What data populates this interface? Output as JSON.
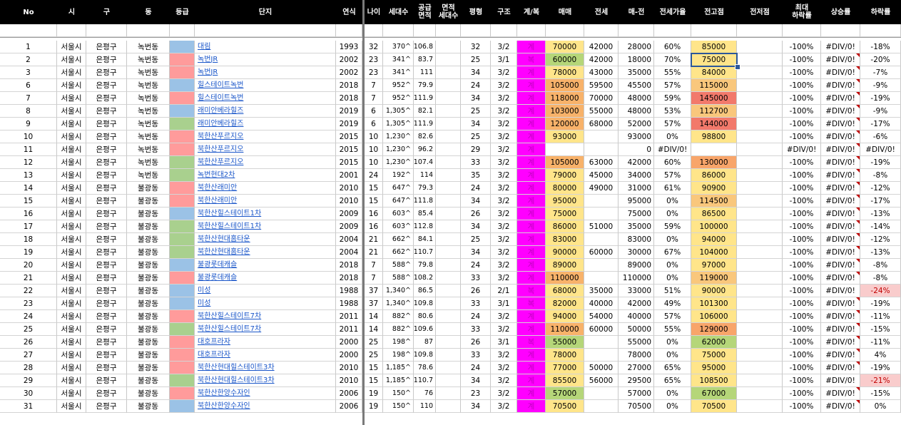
{
  "colors": {
    "header_bg": "#000000",
    "header_text": "#ffffff",
    "grade_blue": "#9bc2e6",
    "grade_red": "#ff9b9b",
    "grade_green": "#a9d08e",
    "jeon_magenta": "#ff00ff",
    "link": "#1a56c9",
    "sale_yellow": "#ffe58a",
    "sale_green": "#b5d679",
    "sale_orange": "#f8b26a",
    "peak_yellow": "#ffe58a",
    "peak_lightorange": "#f9c77c",
    "peak_orange": "#f8a56a",
    "peak_red": "#f2796b",
    "peak_green": "#b5d679",
    "drop_pink": "#f9cccc",
    "selection": "#2b579a"
  },
  "headers": [
    "No",
    "시",
    "구",
    "동",
    "등급",
    "단지",
    "연식",
    "나이",
    "세대수",
    "공급\n면적",
    "면적\n세대수",
    "평형",
    "구조",
    "계/복",
    "매매",
    "전세",
    "매-전",
    "전세가율",
    "전고점",
    "전저점",
    "최대\n하락률",
    "상승률",
    "하락률"
  ],
  "rows": [
    {
      "no": "1",
      "si": "서울시",
      "gu": "은평구",
      "dong": "녹번동",
      "grade": "blue",
      "danji": "대림",
      "year": "1993",
      "age": "32",
      "units": "370^",
      "area": "106.8",
      "area_units": "",
      "pyeong": "32",
      "struct": "3/2",
      "gb": "계",
      "sale": "70000",
      "sale_c": "yellow",
      "jeon": "42000",
      "mj": "28000",
      "rate": "60%",
      "peak": "85000",
      "peak_c": "yellow",
      "low": "",
      "maxdrop": "-100%",
      "rise": "#DIV/0!",
      "rise_mark": false,
      "drop": "-18%",
      "drop_c": ""
    },
    {
      "no": "2",
      "si": "서울시",
      "gu": "은평구",
      "dong": "녹번동",
      "grade": "red",
      "danji": "녹번JR",
      "year": "2002",
      "age": "23",
      "units": "341^",
      "area": "83.7",
      "area_units": "",
      "pyeong": "25",
      "struct": "3/1",
      "gb": "복",
      "sale": "60000",
      "sale_c": "green",
      "jeon": "42000",
      "mj": "18000",
      "rate": "70%",
      "peak": "75000",
      "peak_c": "yellow",
      "low": "",
      "maxdrop": "-100%",
      "rise": "#DIV/0!",
      "rise_mark": true,
      "drop": "-20%",
      "drop_c": ""
    },
    {
      "no": "3",
      "si": "서울시",
      "gu": "은평구",
      "dong": "녹번동",
      "grade": "red",
      "danji": "녹번JR",
      "year": "2002",
      "age": "23",
      "units": "341^",
      "area": "111",
      "area_units": "",
      "pyeong": "34",
      "struct": "3/2",
      "gb": "계",
      "sale": "78000",
      "sale_c": "yellow",
      "jeon": "43000",
      "mj": "35000",
      "rate": "55%",
      "peak": "84000",
      "peak_c": "yellow",
      "low": "",
      "maxdrop": "-100%",
      "rise": "#DIV/0!",
      "rise_mark": true,
      "drop": "-7%",
      "drop_c": ""
    },
    {
      "no": "6",
      "si": "서울시",
      "gu": "은평구",
      "dong": "녹번동",
      "grade": "blue",
      "danji": "힐스테이트녹번",
      "year": "2018",
      "age": "7",
      "units": "952^",
      "area": "79.9",
      "area_units": "",
      "pyeong": "24",
      "struct": "3/2",
      "gb": "계",
      "sale": "105000",
      "sale_c": "orange",
      "jeon": "59500",
      "mj": "45500",
      "rate": "57%",
      "peak": "115000",
      "peak_c": "lightorange",
      "low": "",
      "maxdrop": "-100%",
      "rise": "#DIV/0!",
      "rise_mark": true,
      "drop": "-9%",
      "drop_c": ""
    },
    {
      "no": "7",
      "si": "서울시",
      "gu": "은평구",
      "dong": "녹번동",
      "grade": "red",
      "danji": "힐스테이트녹번",
      "year": "2018",
      "age": "7",
      "units": "952^",
      "area": "111.9",
      "area_units": "",
      "pyeong": "34",
      "struct": "3/2",
      "gb": "계",
      "sale": "118000",
      "sale_c": "orange",
      "jeon": "70000",
      "mj": "48000",
      "rate": "59%",
      "peak": "145000",
      "peak_c": "red",
      "low": "",
      "maxdrop": "-100%",
      "rise": "#DIV/0!",
      "rise_mark": true,
      "drop": "-19%",
      "drop_c": ""
    },
    {
      "no": "8",
      "si": "서울시",
      "gu": "은평구",
      "dong": "녹번동",
      "grade": "blue",
      "danji": "래미안베라힐즈",
      "year": "2019",
      "age": "6",
      "units": "1,305^",
      "area": "82.1",
      "area_units": "",
      "pyeong": "25",
      "struct": "3/2",
      "gb": "계",
      "sale": "103000",
      "sale_c": "orange",
      "jeon": "55000",
      "mj": "48000",
      "rate": "53%",
      "peak": "112700",
      "peak_c": "lightorange",
      "low": "",
      "maxdrop": "-100%",
      "rise": "#DIV/0!",
      "rise_mark": true,
      "drop": "-9%",
      "drop_c": ""
    },
    {
      "no": "9",
      "si": "서울시",
      "gu": "은평구",
      "dong": "녹번동",
      "grade": "green",
      "danji": "래미안베라힐즈",
      "year": "2019",
      "age": "6",
      "units": "1,305^",
      "area": "111.9",
      "area_units": "",
      "pyeong": "34",
      "struct": "3/2",
      "gb": "계",
      "sale": "120000",
      "sale_c": "orange",
      "jeon": "68000",
      "mj": "52000",
      "rate": "57%",
      "peak": "144000",
      "peak_c": "red",
      "low": "",
      "maxdrop": "-100%",
      "rise": "#DIV/0!",
      "rise_mark": true,
      "drop": "-17%",
      "drop_c": ""
    },
    {
      "no": "10",
      "si": "서울시",
      "gu": "은평구",
      "dong": "녹번동",
      "grade": "red",
      "danji": "북한산푸르지오",
      "year": "2015",
      "age": "10",
      "units": "1,230^",
      "area": "82.6",
      "area_units": "",
      "pyeong": "25",
      "struct": "3/2",
      "gb": "계",
      "sale": "93000",
      "sale_c": "yellow",
      "jeon": "",
      "mj": "93000",
      "rate": "0%",
      "peak": "98800",
      "peak_c": "yellow",
      "low": "",
      "maxdrop": "-100%",
      "rise": "#DIV/0!",
      "rise_mark": true,
      "drop": "-6%",
      "drop_c": ""
    },
    {
      "no": "11",
      "si": "서울시",
      "gu": "은평구",
      "dong": "녹번동",
      "grade": "red",
      "danji": "북한산푸르지오",
      "year": "2015",
      "age": "10",
      "units": "1,230^",
      "area": "96.2",
      "area_units": "",
      "pyeong": "29",
      "struct": "3/2",
      "gb": "계",
      "sale": "",
      "sale_c": "",
      "jeon": "",
      "mj": "0",
      "rate": "#DIV/0!",
      "peak": "",
      "peak_c": "",
      "low": "",
      "maxdrop": "#DIV/0!",
      "rise": "#DIV/0!",
      "rise_mark": true,
      "drop": "#DIV/0!",
      "drop_c": ""
    },
    {
      "no": "12",
      "si": "서울시",
      "gu": "은평구",
      "dong": "녹번동",
      "grade": "green",
      "danji": "북한산푸르지오",
      "year": "2015",
      "age": "10",
      "units": "1,230^",
      "area": "107.4",
      "area_units": "",
      "pyeong": "33",
      "struct": "3/2",
      "gb": "계",
      "sale": "105000",
      "sale_c": "orange",
      "jeon": "63000",
      "mj": "42000",
      "rate": "60%",
      "peak": "130000",
      "peak_c": "orange",
      "low": "",
      "maxdrop": "-100%",
      "rise": "#DIV/0!",
      "rise_mark": true,
      "drop": "-19%",
      "drop_c": ""
    },
    {
      "no": "13",
      "si": "서울시",
      "gu": "은평구",
      "dong": "녹번동",
      "grade": "green",
      "danji": "녹번현대2차",
      "year": "2001",
      "age": "24",
      "units": "192^",
      "area": "114",
      "area_units": "",
      "pyeong": "35",
      "struct": "3/2",
      "gb": "계",
      "sale": "79000",
      "sale_c": "yellow",
      "jeon": "45000",
      "mj": "34000",
      "rate": "57%",
      "peak": "86000",
      "peak_c": "yellow",
      "low": "",
      "maxdrop": "-100%",
      "rise": "#DIV/0!",
      "rise_mark": true,
      "drop": "-8%",
      "drop_c": ""
    },
    {
      "no": "14",
      "si": "서울시",
      "gu": "은평구",
      "dong": "불광동",
      "grade": "red",
      "danji": "북한산래미안",
      "year": "2010",
      "age": "15",
      "units": "647^",
      "area": "79.3",
      "area_units": "",
      "pyeong": "24",
      "struct": "3/2",
      "gb": "계",
      "sale": "80000",
      "sale_c": "yellow",
      "jeon": "49000",
      "mj": "31000",
      "rate": "61%",
      "peak": "90900",
      "peak_c": "yellow",
      "low": "",
      "maxdrop": "-100%",
      "rise": "#DIV/0!",
      "rise_mark": true,
      "drop": "-12%",
      "drop_c": ""
    },
    {
      "no": "15",
      "si": "서울시",
      "gu": "은평구",
      "dong": "불광동",
      "grade": "red",
      "danji": "북한산래미안",
      "year": "2010",
      "age": "15",
      "units": "647^",
      "area": "111.8",
      "area_units": "",
      "pyeong": "34",
      "struct": "3/2",
      "gb": "계",
      "sale": "95000",
      "sale_c": "yellow",
      "jeon": "",
      "mj": "95000",
      "rate": "0%",
      "peak": "114500",
      "peak_c": "lightorange",
      "low": "",
      "maxdrop": "-100%",
      "rise": "#DIV/0!",
      "rise_mark": true,
      "drop": "-17%",
      "drop_c": ""
    },
    {
      "no": "16",
      "si": "서울시",
      "gu": "은평구",
      "dong": "불광동",
      "grade": "blue",
      "danji": "북한산힐스테이트1차",
      "year": "2009",
      "age": "16",
      "units": "603^",
      "area": "85.4",
      "area_units": "",
      "pyeong": "26",
      "struct": "3/2",
      "gb": "계",
      "sale": "75000",
      "sale_c": "yellow",
      "jeon": "",
      "mj": "75000",
      "rate": "0%",
      "peak": "86500",
      "peak_c": "yellow",
      "low": "",
      "maxdrop": "-100%",
      "rise": "#DIV/0!",
      "rise_mark": true,
      "drop": "-13%",
      "drop_c": ""
    },
    {
      "no": "17",
      "si": "서울시",
      "gu": "은평구",
      "dong": "불광동",
      "grade": "green",
      "danji": "북한산힐스테이트1차",
      "year": "2009",
      "age": "16",
      "units": "603^",
      "area": "112.8",
      "area_units": "",
      "pyeong": "34",
      "struct": "3/2",
      "gb": "계",
      "sale": "86000",
      "sale_c": "yellow",
      "jeon": "51000",
      "mj": "35000",
      "rate": "59%",
      "peak": "100000",
      "peak_c": "yellow",
      "low": "",
      "maxdrop": "-100%",
      "rise": "#DIV/0!",
      "rise_mark": true,
      "drop": "-14%",
      "drop_c": ""
    },
    {
      "no": "18",
      "si": "서울시",
      "gu": "은평구",
      "dong": "불광동",
      "grade": "green",
      "danji": "북한산현대홈타운",
      "year": "2004",
      "age": "21",
      "units": "662^",
      "area": "84.1",
      "area_units": "",
      "pyeong": "25",
      "struct": "3/2",
      "gb": "계",
      "sale": "83000",
      "sale_c": "yellow",
      "jeon": "",
      "mj": "83000",
      "rate": "0%",
      "peak": "94000",
      "peak_c": "yellow",
      "low": "",
      "maxdrop": "-100%",
      "rise": "#DIV/0!",
      "rise_mark": true,
      "drop": "-12%",
      "drop_c": ""
    },
    {
      "no": "19",
      "si": "서울시",
      "gu": "은평구",
      "dong": "불광동",
      "grade": "green",
      "danji": "북한산현대홈타운",
      "year": "2004",
      "age": "21",
      "units": "662^",
      "area": "110.7",
      "area_units": "",
      "pyeong": "34",
      "struct": "3/2",
      "gb": "계",
      "sale": "90000",
      "sale_c": "yellow",
      "jeon": "60000",
      "mj": "30000",
      "rate": "67%",
      "peak": "104000",
      "peak_c": "yellow",
      "low": "",
      "maxdrop": "-100%",
      "rise": "#DIV/0!",
      "rise_mark": true,
      "drop": "-13%",
      "drop_c": ""
    },
    {
      "no": "20",
      "si": "서울시",
      "gu": "은평구",
      "dong": "불광동",
      "grade": "blue",
      "danji": "불광롯데캐슬",
      "year": "2018",
      "age": "7",
      "units": "588^",
      "area": "79.8",
      "area_units": "",
      "pyeong": "24",
      "struct": "3/2",
      "gb": "계",
      "sale": "89000",
      "sale_c": "yellow",
      "jeon": "",
      "mj": "89000",
      "rate": "0%",
      "peak": "97000",
      "peak_c": "yellow",
      "low": "",
      "maxdrop": "-100%",
      "rise": "#DIV/0!",
      "rise_mark": true,
      "drop": "-8%",
      "drop_c": ""
    },
    {
      "no": "21",
      "si": "서울시",
      "gu": "은평구",
      "dong": "불광동",
      "grade": "red",
      "danji": "불광롯데캐슬",
      "year": "2018",
      "age": "7",
      "units": "588^",
      "area": "108.2",
      "area_units": "",
      "pyeong": "33",
      "struct": "3/2",
      "gb": "계",
      "sale": "110000",
      "sale_c": "orange",
      "jeon": "",
      "mj": "110000",
      "rate": "0%",
      "peak": "119000",
      "peak_c": "lightorange",
      "low": "",
      "maxdrop": "-100%",
      "rise": "#DIV/0!",
      "rise_mark": true,
      "drop": "-8%",
      "drop_c": ""
    },
    {
      "no": "22",
      "si": "서울시",
      "gu": "은평구",
      "dong": "불광동",
      "grade": "blue",
      "danji": "미성",
      "year": "1988",
      "age": "37",
      "units": "1,340^",
      "area": "86.5",
      "area_units": "",
      "pyeong": "26",
      "struct": "2/1",
      "gb": "복",
      "sale": "68000",
      "sale_c": "yellow",
      "jeon": "35000",
      "mj": "33000",
      "rate": "51%",
      "peak": "90000",
      "peak_c": "yellow",
      "low": "",
      "maxdrop": "-100%",
      "rise": "#DIV/0!",
      "rise_mark": false,
      "drop": "-24%",
      "drop_c": "pink"
    },
    {
      "no": "23",
      "si": "서울시",
      "gu": "은평구",
      "dong": "불광동",
      "grade": "blue",
      "danji": "미성",
      "year": "1988",
      "age": "37",
      "units": "1,340^",
      "area": "109.8",
      "area_units": "",
      "pyeong": "33",
      "struct": "3/1",
      "gb": "복",
      "sale": "82000",
      "sale_c": "yellow",
      "jeon": "40000",
      "mj": "42000",
      "rate": "49%",
      "peak": "101300",
      "peak_c": "yellow",
      "low": "",
      "maxdrop": "-100%",
      "rise": "#DIV/0!",
      "rise_mark": true,
      "drop": "-19%",
      "drop_c": ""
    },
    {
      "no": "24",
      "si": "서울시",
      "gu": "은평구",
      "dong": "불광동",
      "grade": "red",
      "danji": "북한산힐스테이트7차",
      "year": "2011",
      "age": "14",
      "units": "882^",
      "area": "80.6",
      "area_units": "",
      "pyeong": "24",
      "struct": "3/2",
      "gb": "계",
      "sale": "94000",
      "sale_c": "yellow",
      "jeon": "54000",
      "mj": "40000",
      "rate": "57%",
      "peak": "106000",
      "peak_c": "yellow",
      "low": "",
      "maxdrop": "-100%",
      "rise": "#DIV/0!",
      "rise_mark": true,
      "drop": "-11%",
      "drop_c": ""
    },
    {
      "no": "25",
      "si": "서울시",
      "gu": "은평구",
      "dong": "불광동",
      "grade": "green",
      "danji": "북한산힐스테이트7차",
      "year": "2011",
      "age": "14",
      "units": "882^",
      "area": "109.6",
      "area_units": "",
      "pyeong": "33",
      "struct": "3/2",
      "gb": "계",
      "sale": "110000",
      "sale_c": "orange",
      "jeon": "60000",
      "mj": "50000",
      "rate": "55%",
      "peak": "129000",
      "peak_c": "orange",
      "low": "",
      "maxdrop": "-100%",
      "rise": "#DIV/0!",
      "rise_mark": true,
      "drop": "-15%",
      "drop_c": ""
    },
    {
      "no": "26",
      "si": "서울시",
      "gu": "은평구",
      "dong": "불광동",
      "grade": "red",
      "danji": "대호프라자",
      "year": "2000",
      "age": "25",
      "units": "198^",
      "area": "87",
      "area_units": "",
      "pyeong": "26",
      "struct": "3/1",
      "gb": "복",
      "sale": "55000",
      "sale_c": "green",
      "jeon": "",
      "mj": "55000",
      "rate": "0%",
      "peak": "62000",
      "peak_c": "green",
      "low": "",
      "maxdrop": "-100%",
      "rise": "#DIV/0!",
      "rise_mark": true,
      "drop": "-11%",
      "drop_c": ""
    },
    {
      "no": "27",
      "si": "서울시",
      "gu": "은평구",
      "dong": "불광동",
      "grade": "red",
      "danji": "대호프라자",
      "year": "2000",
      "age": "25",
      "units": "198^",
      "area": "109.8",
      "area_units": "",
      "pyeong": "33",
      "struct": "3/2",
      "gb": "계",
      "sale": "78000",
      "sale_c": "yellow",
      "jeon": "",
      "mj": "78000",
      "rate": "0%",
      "peak": "75000",
      "peak_c": "yellow",
      "low": "",
      "maxdrop": "-100%",
      "rise": "#DIV/0!",
      "rise_mark": true,
      "drop": "4%",
      "drop_c": ""
    },
    {
      "no": "28",
      "si": "서울시",
      "gu": "은평구",
      "dong": "불광동",
      "grade": "red",
      "danji": "북한산현대힐스테이트3차",
      "year": "2010",
      "age": "15",
      "units": "1,185^",
      "area": "78.6",
      "area_units": "",
      "pyeong": "24",
      "struct": "3/2",
      "gb": "계",
      "sale": "77000",
      "sale_c": "yellow",
      "jeon": "50000",
      "mj": "27000",
      "rate": "65%",
      "peak": "95000",
      "peak_c": "yellow",
      "low": "",
      "maxdrop": "-100%",
      "rise": "#DIV/0!",
      "rise_mark": true,
      "drop": "-19%",
      "drop_c": ""
    },
    {
      "no": "29",
      "si": "서울시",
      "gu": "은평구",
      "dong": "불광동",
      "grade": "green",
      "danji": "북한산현대힐스테이트3차",
      "year": "2010",
      "age": "15",
      "units": "1,185^",
      "area": "110.7",
      "area_units": "",
      "pyeong": "34",
      "struct": "3/2",
      "gb": "계",
      "sale": "85500",
      "sale_c": "yellow",
      "jeon": "56000",
      "mj": "29500",
      "rate": "65%",
      "peak": "108500",
      "peak_c": "yellow",
      "low": "",
      "maxdrop": "-100%",
      "rise": "#DIV/0!",
      "rise_mark": false,
      "drop": "-21%",
      "drop_c": "pink"
    },
    {
      "no": "30",
      "si": "서울시",
      "gu": "은평구",
      "dong": "불광동",
      "grade": "red",
      "danji": "북한산한양수자인",
      "year": "2006",
      "age": "19",
      "units": "150^",
      "area": "76",
      "area_units": "",
      "pyeong": "23",
      "struct": "3/2",
      "gb": "계",
      "sale": "57000",
      "sale_c": "green",
      "jeon": "",
      "mj": "57000",
      "rate": "0%",
      "peak": "67000",
      "peak_c": "green",
      "low": "",
      "maxdrop": "-100%",
      "rise": "#DIV/0!",
      "rise_mark": true,
      "drop": "-15%",
      "drop_c": ""
    },
    {
      "no": "31",
      "si": "서울시",
      "gu": "은평구",
      "dong": "불광동",
      "grade": "blue",
      "danji": "북한산한양수자인",
      "year": "2006",
      "age": "19",
      "units": "150^",
      "area": "110",
      "area_units": "",
      "pyeong": "34",
      "struct": "3/2",
      "gb": "계",
      "sale": "70500",
      "sale_c": "yellow",
      "jeon": "",
      "mj": "70500",
      "rate": "0%",
      "peak": "70500",
      "peak_c": "yellow",
      "low": "",
      "maxdrop": "-100%",
      "rise": "#DIV/0!",
      "rise_mark": true,
      "drop": "0%",
      "drop_c": ""
    }
  ]
}
